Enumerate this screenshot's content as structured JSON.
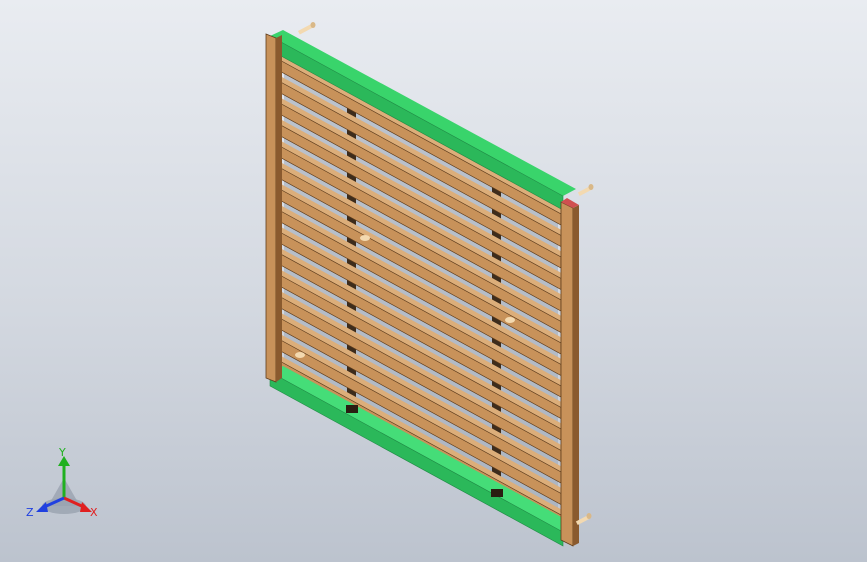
{
  "viewport": {
    "background_top": "#e9ecf1",
    "background_bottom": "#bcc3ce"
  },
  "model": {
    "slat_count": 15,
    "colors": {
      "wood_face": "#c8925a",
      "wood_edge": "#7a5028",
      "wood_dark": "#5e3c1c",
      "rail_green": "#33cc66",
      "rail_green_dark": "#1e8a44",
      "dowel": "#f3d9b0",
      "end_cap": "#d05050"
    }
  },
  "triad": {
    "x_label": "X",
    "y_label": "Y",
    "z_label": "Z",
    "x_color": "#e02020",
    "y_color": "#20b020",
    "z_color": "#2040e0",
    "x_icon": "x-axis-arrow-icon",
    "y_icon": "y-axis-arrow-icon",
    "z_icon": "z-axis-arrow-icon"
  }
}
